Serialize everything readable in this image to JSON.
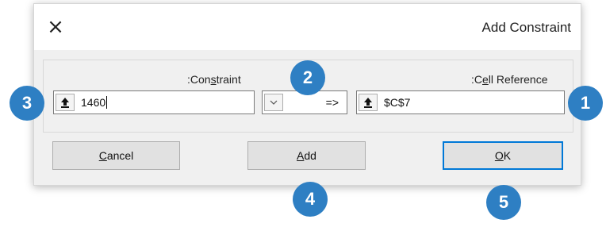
{
  "dialog": {
    "title": "Add Constraint",
    "close_glyph": "×"
  },
  "labels": {
    "constraint_prefix": ":Con",
    "constraint_underline": "s",
    "constraint_suffix": "traint",
    "cell_ref_prefix": ":C",
    "cell_ref_underline": "e",
    "cell_ref_suffix": "ll Reference"
  },
  "fields": {
    "constraint_value": "1460",
    "operator_value": "=>",
    "cell_reference_value": "$C$7"
  },
  "buttons": {
    "cancel_underline": "C",
    "cancel_rest": "ancel",
    "add_underline": "A",
    "add_rest": "dd",
    "ok_underline": "O",
    "ok_rest": "K"
  },
  "callouts": {
    "badge_1": "1",
    "badge_2": "2",
    "badge_3": "3",
    "badge_4": "4",
    "badge_5": "5",
    "color": "#2e7fc3"
  },
  "icons": {
    "collapse": "collapse-dialog-icon",
    "dropdown": "chevron-down-icon",
    "close": "close-icon"
  }
}
